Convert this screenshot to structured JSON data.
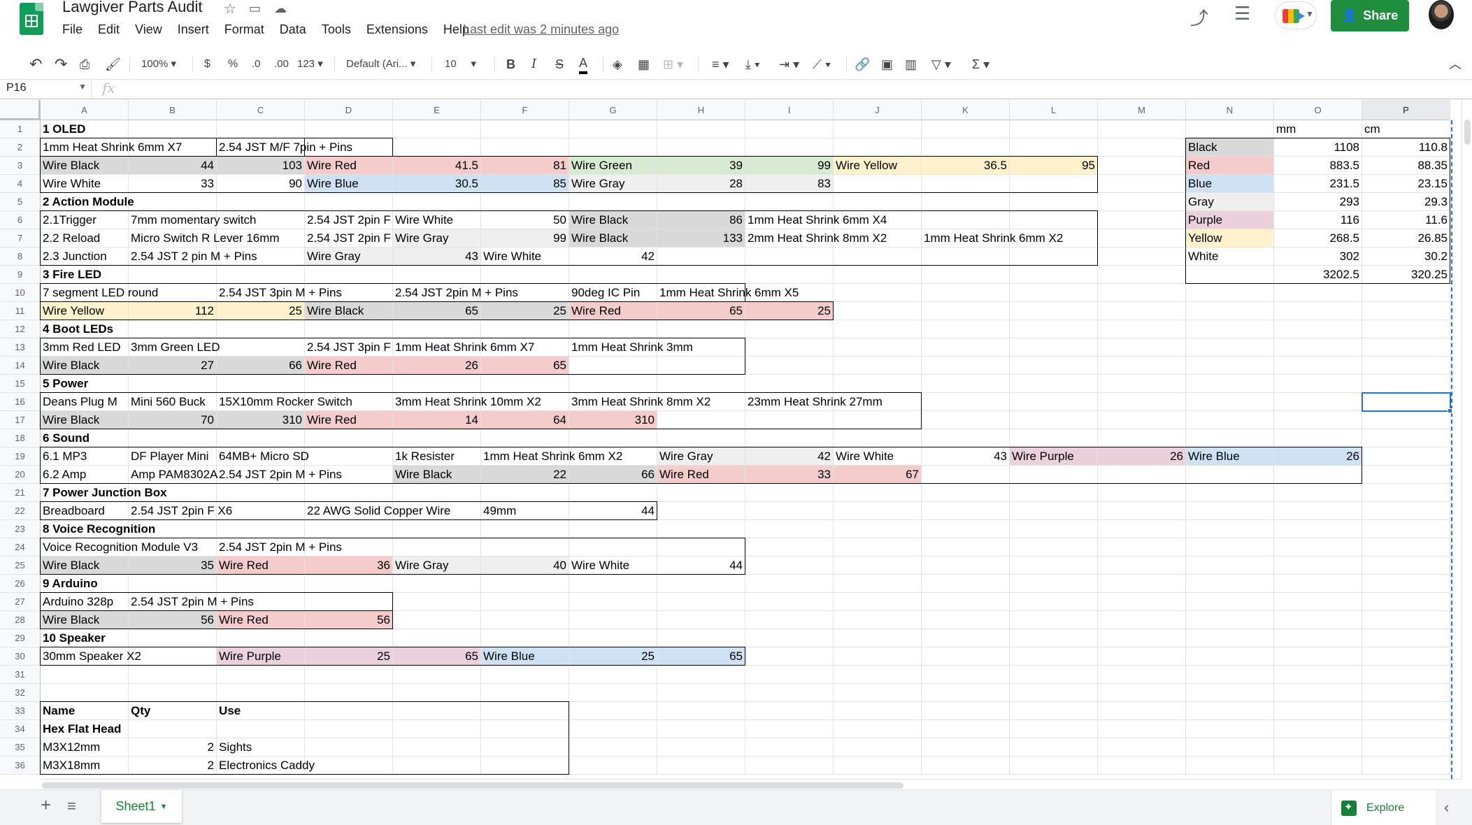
{
  "app": {
    "title": "Lawgiver Parts Audit",
    "last_edit": "Last edit was 2 minutes ago",
    "share_label": "Share",
    "menus": [
      "File",
      "Edit",
      "View",
      "Insert",
      "Format",
      "Data",
      "Tools",
      "Extensions",
      "Help"
    ]
  },
  "toolbar": {
    "zoom": "100%",
    "currency": "$",
    "percent": "%",
    "dec_less": ".0",
    "dec_more": ".00",
    "format_more": "123",
    "font": "Default (Ari...",
    "font_size": "10",
    "bold": "B",
    "italic": "I",
    "strike": "S",
    "textcolor": "A"
  },
  "formula": {
    "cell_ref": "P16",
    "fx": "fx",
    "value": ""
  },
  "sheet": {
    "tab": "Sheet1",
    "explore": "Explore",
    "columns": [
      "A",
      "B",
      "C",
      "D",
      "E",
      "F",
      "G",
      "H",
      "I",
      "J",
      "K",
      "L",
      "M",
      "N",
      "O",
      "P"
    ],
    "selected_col": "P",
    "selected_row": 16,
    "rows": [
      "1",
      "2",
      "3",
      "4",
      "5",
      "6",
      "7",
      "8",
      "9",
      "10",
      "11",
      "12",
      "13",
      "14",
      "15",
      "16",
      "17",
      "18",
      "19",
      "20",
      "21",
      "22",
      "23",
      "24",
      "25",
      "26",
      "27",
      "28",
      "29",
      "30",
      "31",
      "32",
      "33",
      "34",
      "35",
      "36"
    ],
    "colors": {
      "gray": "#d9d9d9",
      "red": "#f4cccc",
      "green": "#d9ead3",
      "yellow": "#fff2cc",
      "blue": "#cfe2f3",
      "purple": "#ead1dc",
      "light_gray": "#efefef",
      "white": "#ffffff",
      "selection": "#1a73e8",
      "brand": "#0f9d58",
      "share": "#1e8e3e"
    },
    "cells": [
      {
        "r": 1,
        "c": 0,
        "v": "1 OLED",
        "b": 1
      },
      {
        "r": 1,
        "c": 14,
        "v": "mm"
      },
      {
        "r": 1,
        "c": 15,
        "v": "cm"
      },
      {
        "r": 2,
        "c": 0,
        "v": "1mm Heat Shrink 6mm X7"
      },
      {
        "r": 2,
        "c": 2,
        "v": "2.54 JST M/F 7pin + Pins"
      },
      {
        "r": 2,
        "c": 13,
        "v": "Black",
        "bg": "gray"
      },
      {
        "r": 2,
        "c": 14,
        "v": "1108",
        "n": 1
      },
      {
        "r": 2,
        "c": 15,
        "v": "110.8",
        "n": 1
      },
      {
        "r": 3,
        "c": 0,
        "v": "Wire Black",
        "bg": "gray"
      },
      {
        "r": 3,
        "c": 1,
        "v": "44",
        "n": 1,
        "bg": "gray"
      },
      {
        "r": 3,
        "c": 2,
        "v": "103",
        "n": 1,
        "bg": "gray"
      },
      {
        "r": 3,
        "c": 3,
        "v": "Wire Red",
        "bg": "red"
      },
      {
        "r": 3,
        "c": 4,
        "v": "41.5",
        "n": 1,
        "bg": "red"
      },
      {
        "r": 3,
        "c": 5,
        "v": "81",
        "n": 1,
        "bg": "red"
      },
      {
        "r": 3,
        "c": 6,
        "v": "Wire Green",
        "bg": "green"
      },
      {
        "r": 3,
        "c": 7,
        "v": "39",
        "n": 1,
        "bg": "green"
      },
      {
        "r": 3,
        "c": 8,
        "v": "99",
        "n": 1,
        "bg": "green"
      },
      {
        "r": 3,
        "c": 9,
        "v": "Wire Yellow",
        "bg": "yellow"
      },
      {
        "r": 3,
        "c": 10,
        "v": "36.5",
        "n": 1,
        "bg": "yellow"
      },
      {
        "r": 3,
        "c": 11,
        "v": "95",
        "n": 1,
        "bg": "yellow"
      },
      {
        "r": 3,
        "c": 13,
        "v": "Red",
        "bg": "red"
      },
      {
        "r": 3,
        "c": 14,
        "v": "883.5",
        "n": 1
      },
      {
        "r": 3,
        "c": 15,
        "v": "88.35",
        "n": 1
      },
      {
        "r": 4,
        "c": 0,
        "v": "Wire White"
      },
      {
        "r": 4,
        "c": 1,
        "v": "33",
        "n": 1
      },
      {
        "r": 4,
        "c": 2,
        "v": "90",
        "n": 1
      },
      {
        "r": 4,
        "c": 3,
        "v": "Wire Blue",
        "bg": "blue"
      },
      {
        "r": 4,
        "c": 4,
        "v": "30.5",
        "n": 1,
        "bg": "blue"
      },
      {
        "r": 4,
        "c": 5,
        "v": "85",
        "n": 1,
        "bg": "blue"
      },
      {
        "r": 4,
        "c": 6,
        "v": "Wire Gray",
        "bg": "light_gray"
      },
      {
        "r": 4,
        "c": 7,
        "v": "28",
        "n": 1,
        "bg": "light_gray"
      },
      {
        "r": 4,
        "c": 8,
        "v": "83",
        "n": 1,
        "bg": "light_gray"
      },
      {
        "r": 4,
        "c": 13,
        "v": "Blue",
        "bg": "blue"
      },
      {
        "r": 4,
        "c": 14,
        "v": "231.5",
        "n": 1
      },
      {
        "r": 4,
        "c": 15,
        "v": "23.15",
        "n": 1
      },
      {
        "r": 5,
        "c": 0,
        "v": "2 Action Module",
        "b": 1
      },
      {
        "r": 5,
        "c": 13,
        "v": "Gray",
        "bg": "light_gray"
      },
      {
        "r": 5,
        "c": 14,
        "v": "293",
        "n": 1
      },
      {
        "r": 5,
        "c": 15,
        "v": "29.3",
        "n": 1
      },
      {
        "r": 6,
        "c": 0,
        "v": "2.1Trigger"
      },
      {
        "r": 6,
        "c": 1,
        "v": "7mm momentary switch"
      },
      {
        "r": 6,
        "c": 3,
        "v": "2.54 JST 2pin F"
      },
      {
        "r": 6,
        "c": 4,
        "v": "Wire White"
      },
      {
        "r": 6,
        "c": 5,
        "v": "50",
        "n": 1
      },
      {
        "r": 6,
        "c": 6,
        "v": "Wire Black",
        "bg": "gray"
      },
      {
        "r": 6,
        "c": 7,
        "v": "86",
        "n": 1,
        "bg": "gray"
      },
      {
        "r": 6,
        "c": 8,
        "v": "1mm Heat Shrink 6mm X4"
      },
      {
        "r": 6,
        "c": 13,
        "v": "Purple",
        "bg": "purple"
      },
      {
        "r": 6,
        "c": 14,
        "v": "116",
        "n": 1
      },
      {
        "r": 6,
        "c": 15,
        "v": "11.6",
        "n": 1
      },
      {
        "r": 7,
        "c": 0,
        "v": "2.2 Reload"
      },
      {
        "r": 7,
        "c": 1,
        "v": "Micro Switch R Lever 16mm"
      },
      {
        "r": 7,
        "c": 3,
        "v": "2.54 JST 2pin F"
      },
      {
        "r": 7,
        "c": 4,
        "v": "Wire Gray",
        "bg": "light_gray"
      },
      {
        "r": 7,
        "c": 5,
        "v": "99",
        "n": 1,
        "bg": "light_gray"
      },
      {
        "r": 7,
        "c": 6,
        "v": "Wire Black",
        "bg": "gray"
      },
      {
        "r": 7,
        "c": 7,
        "v": "133",
        "n": 1,
        "bg": "gray"
      },
      {
        "r": 7,
        "c": 8,
        "v": "2mm Heat Shrink 8mm X2"
      },
      {
        "r": 7,
        "c": 10,
        "v": "1mm Heat Shrink 6mm X2"
      },
      {
        "r": 7,
        "c": 13,
        "v": "Yellow",
        "bg": "yellow"
      },
      {
        "r": 7,
        "c": 14,
        "v": "268.5",
        "n": 1
      },
      {
        "r": 7,
        "c": 15,
        "v": "26.85",
        "n": 1
      },
      {
        "r": 8,
        "c": 0,
        "v": "2.3 Junction"
      },
      {
        "r": 8,
        "c": 1,
        "v": "2.54 JST 2 pin M + Pins"
      },
      {
        "r": 8,
        "c": 3,
        "v": "Wire Gray",
        "bg": "light_gray"
      },
      {
        "r": 8,
        "c": 4,
        "v": "43",
        "n": 1,
        "bg": "light_gray"
      },
      {
        "r": 8,
        "c": 5,
        "v": "Wire White"
      },
      {
        "r": 8,
        "c": 6,
        "v": "42",
        "n": 1
      },
      {
        "r": 8,
        "c": 13,
        "v": "White"
      },
      {
        "r": 8,
        "c": 14,
        "v": "302",
        "n": 1
      },
      {
        "r": 8,
        "c": 15,
        "v": "30.2",
        "n": 1
      },
      {
        "r": 9,
        "c": 0,
        "v": "3 Fire LED",
        "b": 1
      },
      {
        "r": 9,
        "c": 14,
        "v": "3202.5",
        "n": 1
      },
      {
        "r": 9,
        "c": 15,
        "v": "320.25",
        "n": 1
      },
      {
        "r": 10,
        "c": 0,
        "v": "7 segment LED round"
      },
      {
        "r": 10,
        "c": 2,
        "v": "2.54 JST 3pin M + Pins"
      },
      {
        "r": 10,
        "c": 4,
        "v": "2.54 JST 2pin M + Pins"
      },
      {
        "r": 10,
        "c": 6,
        "v": "90deg IC Pin"
      },
      {
        "r": 10,
        "c": 7,
        "v": "1mm Heat Shrink 6mm X5"
      },
      {
        "r": 11,
        "c": 0,
        "v": "Wire Yellow",
        "bg": "yellow"
      },
      {
        "r": 11,
        "c": 1,
        "v": "112",
        "n": 1,
        "bg": "yellow"
      },
      {
        "r": 11,
        "c": 2,
        "v": "25",
        "n": 1,
        "bg": "yellow"
      },
      {
        "r": 11,
        "c": 3,
        "v": "Wire Black",
        "bg": "gray"
      },
      {
        "r": 11,
        "c": 4,
        "v": "65",
        "n": 1,
        "bg": "gray"
      },
      {
        "r": 11,
        "c": 5,
        "v": "25",
        "n": 1,
        "bg": "gray"
      },
      {
        "r": 11,
        "c": 6,
        "v": "Wire Red",
        "bg": "red"
      },
      {
        "r": 11,
        "c": 7,
        "v": "65",
        "n": 1,
        "bg": "red"
      },
      {
        "r": 11,
        "c": 8,
        "v": "25",
        "n": 1,
        "bg": "red"
      },
      {
        "r": 12,
        "c": 0,
        "v": "4 Boot LEDs",
        "b": 1
      },
      {
        "r": 13,
        "c": 0,
        "v": "3mm Red LED"
      },
      {
        "r": 13,
        "c": 1,
        "v": "3mm Green LED"
      },
      {
        "r": 13,
        "c": 3,
        "v": "2.54 JST 3pin F"
      },
      {
        "r": 13,
        "c": 4,
        "v": "1mm Heat Shrink 6mm X7"
      },
      {
        "r": 13,
        "c": 6,
        "v": "1mm Heat Shrink 3mm"
      },
      {
        "r": 14,
        "c": 0,
        "v": "Wire Black",
        "bg": "gray"
      },
      {
        "r": 14,
        "c": 1,
        "v": "27",
        "n": 1,
        "bg": "gray"
      },
      {
        "r": 14,
        "c": 2,
        "v": "66",
        "n": 1,
        "bg": "gray"
      },
      {
        "r": 14,
        "c": 3,
        "v": "Wire Red",
        "bg": "red"
      },
      {
        "r": 14,
        "c": 4,
        "v": "26",
        "n": 1,
        "bg": "red"
      },
      {
        "r": 14,
        "c": 5,
        "v": "65",
        "n": 1,
        "bg": "red"
      },
      {
        "r": 15,
        "c": 0,
        "v": "5 Power",
        "b": 1
      },
      {
        "r": 16,
        "c": 0,
        "v": "Deans Plug M"
      },
      {
        "r": 16,
        "c": 1,
        "v": "Mini 560 Buck"
      },
      {
        "r": 16,
        "c": 2,
        "v": "15X10mm Rocker Switch"
      },
      {
        "r": 16,
        "c": 4,
        "v": "3mm Heat Shrink 10mm X2"
      },
      {
        "r": 16,
        "c": 6,
        "v": "3mm Heat Shrink 8mm X2"
      },
      {
        "r": 16,
        "c": 8,
        "v": "23mm Heat Shrink 27mm"
      },
      {
        "r": 17,
        "c": 0,
        "v": "Wire Black",
        "bg": "gray"
      },
      {
        "r": 17,
        "c": 1,
        "v": "70",
        "n": 1,
        "bg": "gray"
      },
      {
        "r": 17,
        "c": 2,
        "v": "310",
        "n": 1,
        "bg": "gray"
      },
      {
        "r": 17,
        "c": 3,
        "v": "Wire Red",
        "bg": "red"
      },
      {
        "r": 17,
        "c": 4,
        "v": "14",
        "n": 1,
        "bg": "red"
      },
      {
        "r": 17,
        "c": 5,
        "v": "64",
        "n": 1,
        "bg": "red"
      },
      {
        "r": 17,
        "c": 6,
        "v": "310",
        "n": 1,
        "bg": "red"
      },
      {
        "r": 18,
        "c": 0,
        "v": "6 Sound",
        "b": 1
      },
      {
        "r": 19,
        "c": 0,
        "v": "6.1 MP3"
      },
      {
        "r": 19,
        "c": 1,
        "v": "DF Player Mini"
      },
      {
        "r": 19,
        "c": 2,
        "v": "64MB+ Micro SD"
      },
      {
        "r": 19,
        "c": 4,
        "v": "1k Resister"
      },
      {
        "r": 19,
        "c": 5,
        "v": "1mm Heat Shrink 6mm X2"
      },
      {
        "r": 19,
        "c": 7,
        "v": "Wire Gray",
        "bg": "light_gray"
      },
      {
        "r": 19,
        "c": 8,
        "v": "42",
        "n": 1,
        "bg": "light_gray"
      },
      {
        "r": 19,
        "c": 9,
        "v": "Wire White"
      },
      {
        "r": 19,
        "c": 10,
        "v": "43",
        "n": 1
      },
      {
        "r": 19,
        "c": 11,
        "v": "Wire Purple",
        "bg": "purple"
      },
      {
        "r": 19,
        "c": 12,
        "v": "26",
        "n": 1,
        "bg": "purple"
      },
      {
        "r": 19,
        "c": 13,
        "v": "Wire Blue",
        "bg": "blue"
      },
      {
        "r": 19,
        "c": 14,
        "v": "26",
        "n": 1,
        "bg": "blue"
      },
      {
        "r": 20,
        "c": 0,
        "v": "6.2 Amp"
      },
      {
        "r": 20,
        "c": 1,
        "v": "Amp PAM8302A"
      },
      {
        "r": 20,
        "c": 2,
        "v": "2.54 JST 2pin M + Pins"
      },
      {
        "r": 20,
        "c": 4,
        "v": "Wire Black",
        "bg": "gray"
      },
      {
        "r": 20,
        "c": 5,
        "v": "22",
        "n": 1,
        "bg": "gray"
      },
      {
        "r": 20,
        "c": 6,
        "v": "66",
        "n": 1,
        "bg": "gray"
      },
      {
        "r": 20,
        "c": 7,
        "v": "Wire Red",
        "bg": "red"
      },
      {
        "r": 20,
        "c": 8,
        "v": "33",
        "n": 1,
        "bg": "red"
      },
      {
        "r": 20,
        "c": 9,
        "v": "67",
        "n": 1,
        "bg": "red"
      },
      {
        "r": 21,
        "c": 0,
        "v": "7 Power Junction Box",
        "b": 1
      },
      {
        "r": 22,
        "c": 0,
        "v": "Breadboard"
      },
      {
        "r": 22,
        "c": 1,
        "v": "2.54 JST 2pin F X6"
      },
      {
        "r": 22,
        "c": 3,
        "v": "22 AWG Solid Copper Wire"
      },
      {
        "r": 22,
        "c": 5,
        "v": "49mm"
      },
      {
        "r": 22,
        "c": 6,
        "v": "44",
        "n": 1
      },
      {
        "r": 23,
        "c": 0,
        "v": "8 Voice Recognition",
        "b": 1
      },
      {
        "r": 24,
        "c": 0,
        "v": "Voice Recognition Module V3"
      },
      {
        "r": 24,
        "c": 2,
        "v": "2.54 JST 2pin M + Pins"
      },
      {
        "r": 25,
        "c": 0,
        "v": "Wire Black",
        "bg": "gray"
      },
      {
        "r": 25,
        "c": 1,
        "v": "35",
        "n": 1,
        "bg": "gray"
      },
      {
        "r": 25,
        "c": 2,
        "v": "Wire Red",
        "bg": "red"
      },
      {
        "r": 25,
        "c": 3,
        "v": "36",
        "n": 1,
        "bg": "red"
      },
      {
        "r": 25,
        "c": 4,
        "v": "Wire Gray",
        "bg": "light_gray"
      },
      {
        "r": 25,
        "c": 5,
        "v": "40",
        "n": 1,
        "bg": "light_gray"
      },
      {
        "r": 25,
        "c": 6,
        "v": "Wire White"
      },
      {
        "r": 25,
        "c": 7,
        "v": "44",
        "n": 1
      },
      {
        "r": 26,
        "c": 0,
        "v": "9 Arduino",
        "b": 1
      },
      {
        "r": 27,
        "c": 0,
        "v": "Arduino 328p"
      },
      {
        "r": 27,
        "c": 1,
        "v": "2.54 JST 2pin M + Pins"
      },
      {
        "r": 28,
        "c": 0,
        "v": "Wire Black",
        "bg": "gray"
      },
      {
        "r": 28,
        "c": 1,
        "v": "56",
        "n": 1,
        "bg": "gray"
      },
      {
        "r": 28,
        "c": 2,
        "v": "Wire Red",
        "bg": "red"
      },
      {
        "r": 28,
        "c": 3,
        "v": "56",
        "n": 1,
        "bg": "red"
      },
      {
        "r": 29,
        "c": 0,
        "v": "10 Speaker",
        "b": 1
      },
      {
        "r": 30,
        "c": 0,
        "v": "30mm Speaker X2"
      },
      {
        "r": 30,
        "c": 2,
        "v": "Wire Purple",
        "bg": "purple"
      },
      {
        "r": 30,
        "c": 3,
        "v": "25",
        "n": 1,
        "bg": "purple"
      },
      {
        "r": 30,
        "c": 4,
        "v": "65",
        "n": 1,
        "bg": "purple"
      },
      {
        "r": 30,
        "c": 5,
        "v": "Wire Blue",
        "bg": "blue"
      },
      {
        "r": 30,
        "c": 6,
        "v": "25",
        "n": 1,
        "bg": "blue"
      },
      {
        "r": 30,
        "c": 7,
        "v": "65",
        "n": 1,
        "bg": "blue"
      },
      {
        "r": 33,
        "c": 0,
        "v": "Name",
        "b": 1
      },
      {
        "r": 33,
        "c": 1,
        "v": "Qty",
        "b": 1
      },
      {
        "r": 33,
        "c": 2,
        "v": "Use",
        "b": 1
      },
      {
        "r": 34,
        "c": 0,
        "v": "Hex Flat Head",
        "b": 1
      },
      {
        "r": 35,
        "c": 0,
        "v": "M3X12mm"
      },
      {
        "r": 35,
        "c": 1,
        "v": "2",
        "n": 1
      },
      {
        "r": 35,
        "c": 2,
        "v": "Sights"
      },
      {
        "r": 36,
        "c": 0,
        "v": "M3X18mm"
      },
      {
        "r": 36,
        "c": 1,
        "v": "2",
        "n": 1
      },
      {
        "r": 36,
        "c": 2,
        "v": "Electronics Caddy"
      }
    ]
  }
}
